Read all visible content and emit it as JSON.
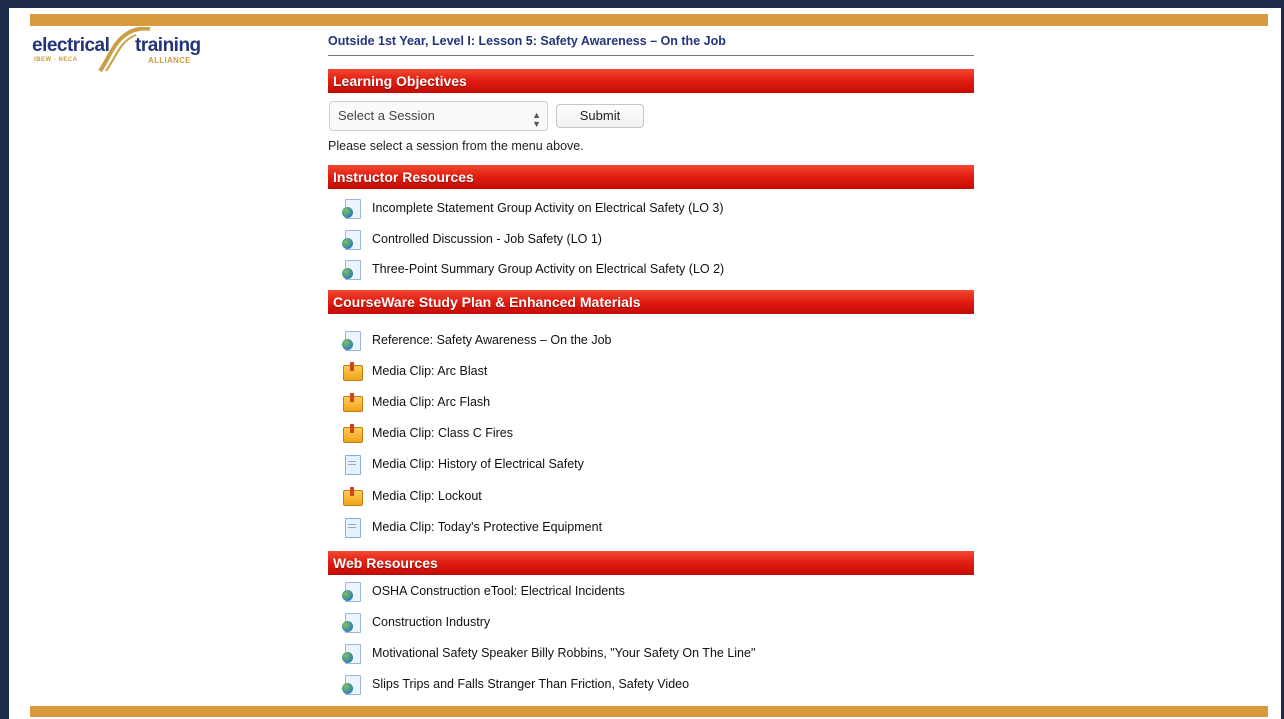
{
  "logo": {
    "word1": "electrical",
    "word2": "training",
    "tag": "IBEW · NECA",
    "alliance": "ALLIANCE"
  },
  "lesson_title": "Outside 1st Year, Level I: Lesson 5: Safety Awareness – On the Job",
  "sections": {
    "learning_objectives": "Learning Objectives",
    "instructor_resources": "Instructor Resources",
    "courseware": "CourseWare Study Plan & Enhanced Materials",
    "web_resources": "Web Resources"
  },
  "session_select": {
    "value": "Select a Session",
    "arrows": "▲▼"
  },
  "submit_label": "Submit",
  "helper_text": "Please select a session from the menu above.",
  "instructor_items": [
    {
      "icon": "web-resource-icon",
      "label": "Incomplete Statement Group Activity on Electrical Safety (LO 3)"
    },
    {
      "icon": "web-resource-icon",
      "label": "Controlled Discussion - Job Safety (LO 1)"
    },
    {
      "icon": "web-resource-icon",
      "label": "Three-Point Summary Group Activity on Electrical Safety (LO 2)"
    }
  ],
  "courseware_items": [
    {
      "icon": "web-resource-icon",
      "label": "Reference: Safety Awareness – On the Job"
    },
    {
      "icon": "package-icon",
      "label": "Media Clip: Arc Blast"
    },
    {
      "icon": "package-icon",
      "label": "Media Clip: Arc Flash"
    },
    {
      "icon": "package-icon",
      "label": "Media Clip: Class C Fires"
    },
    {
      "icon": "document-icon",
      "label": "Media Clip: History of Electrical Safety"
    },
    {
      "icon": "package-icon",
      "label": "Media Clip: Lockout"
    },
    {
      "icon": "document-icon",
      "label": "Media Clip: Today's Protective Equipment"
    }
  ],
  "web_items": [
    {
      "icon": "web-resource-icon",
      "label": "OSHA Construction eTool: Electrical Incidents"
    },
    {
      "icon": "web-resource-icon",
      "label": "Construction Industry"
    },
    {
      "icon": "web-resource-icon",
      "label": "Motivational Safety Speaker Billy Robbins, \"Your Safety On The Line\""
    },
    {
      "icon": "web-resource-icon",
      "label": "Slips Trips and Falls Stranger Than Friction, Safety Video"
    }
  ],
  "colors": {
    "frame": "#1d2b4a",
    "gold": "#d89a3c",
    "section_red": "#e41e12",
    "title_blue": "#23357a"
  }
}
